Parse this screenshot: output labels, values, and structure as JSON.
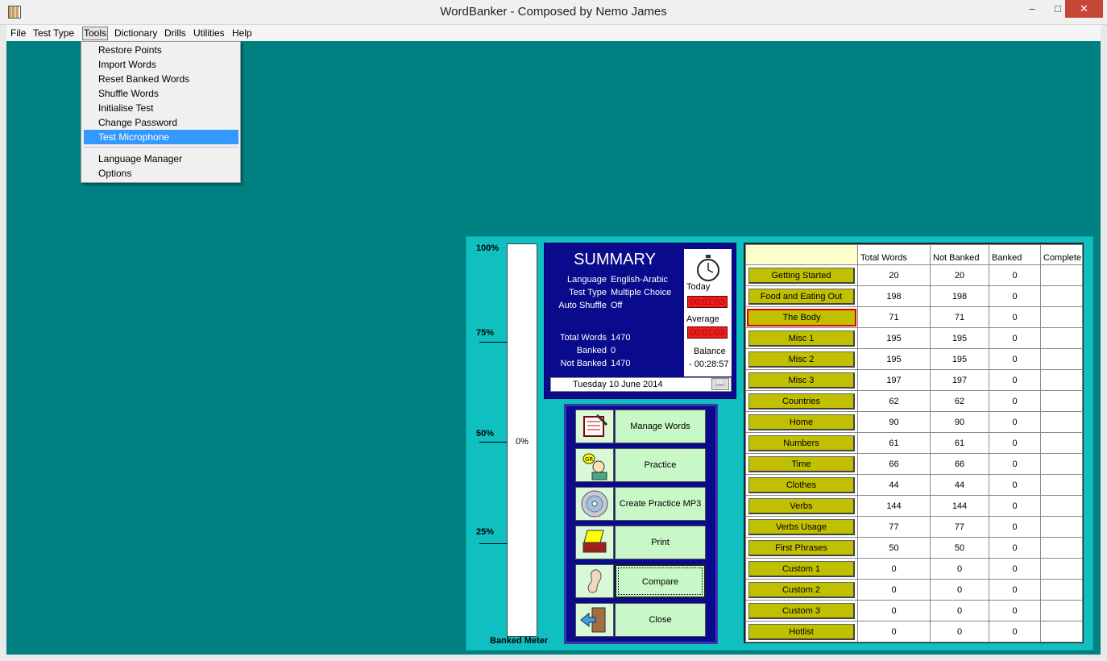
{
  "window": {
    "title": "WordBanker - Composed by Nemo James",
    "min": "–",
    "max": "□",
    "close": "✕"
  },
  "menu": [
    "File",
    "Test Type",
    "Tools",
    "Dictionary",
    "Drills",
    "Utilities",
    "Help"
  ],
  "tools_menu": [
    "Restore Points",
    "Import Words",
    "Reset Banked Words",
    "Shuffle Words",
    "Initialise Test",
    "Change Password",
    "Test Microphone",
    "Language Manager",
    "Options"
  ],
  "selected_tools_item": "Test Microphone",
  "meter": {
    "title": "Banked Meter",
    "value": "0%",
    "ticks": [
      "100%",
      "75%",
      "50%",
      "25%"
    ]
  },
  "summary": {
    "title": "SUMMARY",
    "rows": [
      {
        "k": "Language",
        "v": "English-Arabic"
      },
      {
        "k": "Test Type",
        "v": "Multiple Choice"
      },
      {
        "k": "Auto Shuffle",
        "v": "Off"
      },
      {
        "k": "Total Words",
        "v": "1470"
      },
      {
        "k": "Banked",
        "v": "0"
      },
      {
        "k": "Not Banked",
        "v": "1470"
      }
    ],
    "date": "Tuesday 10 June 2014",
    "today_label": "Today",
    "today_value": "00:01:03",
    "average_label": "Average",
    "average_value": "00:01:03",
    "balance_label": "Balance",
    "balance_value": "- 00:28:57"
  },
  "actions": [
    {
      "label": "Manage Words",
      "icon": "notebook-icon"
    },
    {
      "label": "Practice",
      "icon": "speaking-person-icon"
    },
    {
      "label": "Create Practice MP3",
      "icon": "cd-icon"
    },
    {
      "label": "Print",
      "icon": "printer-icon"
    },
    {
      "label": "Compare",
      "icon": "ear-icon"
    },
    {
      "label": "Close",
      "icon": "exit-door-icon"
    }
  ],
  "table": {
    "headers": [
      "Total Words",
      "Not Banked",
      "Banked",
      "Complete"
    ],
    "rows": [
      {
        "cat": "Getting Started",
        "total": "20",
        "not": "20",
        "banked": "0"
      },
      {
        "cat": "Food and Eating Out",
        "total": "198",
        "not": "198",
        "banked": "0"
      },
      {
        "cat": "The Body",
        "total": "71",
        "not": "71",
        "banked": "0"
      },
      {
        "cat": "Misc 1",
        "total": "195",
        "not": "195",
        "banked": "0"
      },
      {
        "cat": "Misc 2",
        "total": "195",
        "not": "195",
        "banked": "0"
      },
      {
        "cat": "Misc 3",
        "total": "197",
        "not": "197",
        "banked": "0"
      },
      {
        "cat": "Countries",
        "total": "62",
        "not": "62",
        "banked": "0"
      },
      {
        "cat": "Home",
        "total": "90",
        "not": "90",
        "banked": "0"
      },
      {
        "cat": "Numbers",
        "total": "61",
        "not": "61",
        "banked": "0"
      },
      {
        "cat": "Time",
        "total": "66",
        "not": "66",
        "banked": "0"
      },
      {
        "cat": "Clothes",
        "total": "44",
        "not": "44",
        "banked": "0"
      },
      {
        "cat": "Verbs",
        "total": "144",
        "not": "144",
        "banked": "0"
      },
      {
        "cat": "Verbs Usage",
        "total": "77",
        "not": "77",
        "banked": "0"
      },
      {
        "cat": "First Phrases",
        "total": "50",
        "not": "50",
        "banked": "0"
      },
      {
        "cat": "Custom 1",
        "total": "0",
        "not": "0",
        "banked": "0"
      },
      {
        "cat": "Custom 2",
        "total": "0",
        "not": "0",
        "banked": "0"
      },
      {
        "cat": "Custom 3",
        "total": "0",
        "not": "0",
        "banked": "0"
      },
      {
        "cat": "Hotlist",
        "total": "0",
        "not": "0",
        "banked": "0"
      }
    ],
    "active_category": "The Body"
  },
  "colors": {
    "background": "#008080",
    "panel": "#10c0c0",
    "summary": "#0a0a8c",
    "category_button": "#c0c000",
    "action_button": "#c8f8c8",
    "timer": "#e82020"
  }
}
